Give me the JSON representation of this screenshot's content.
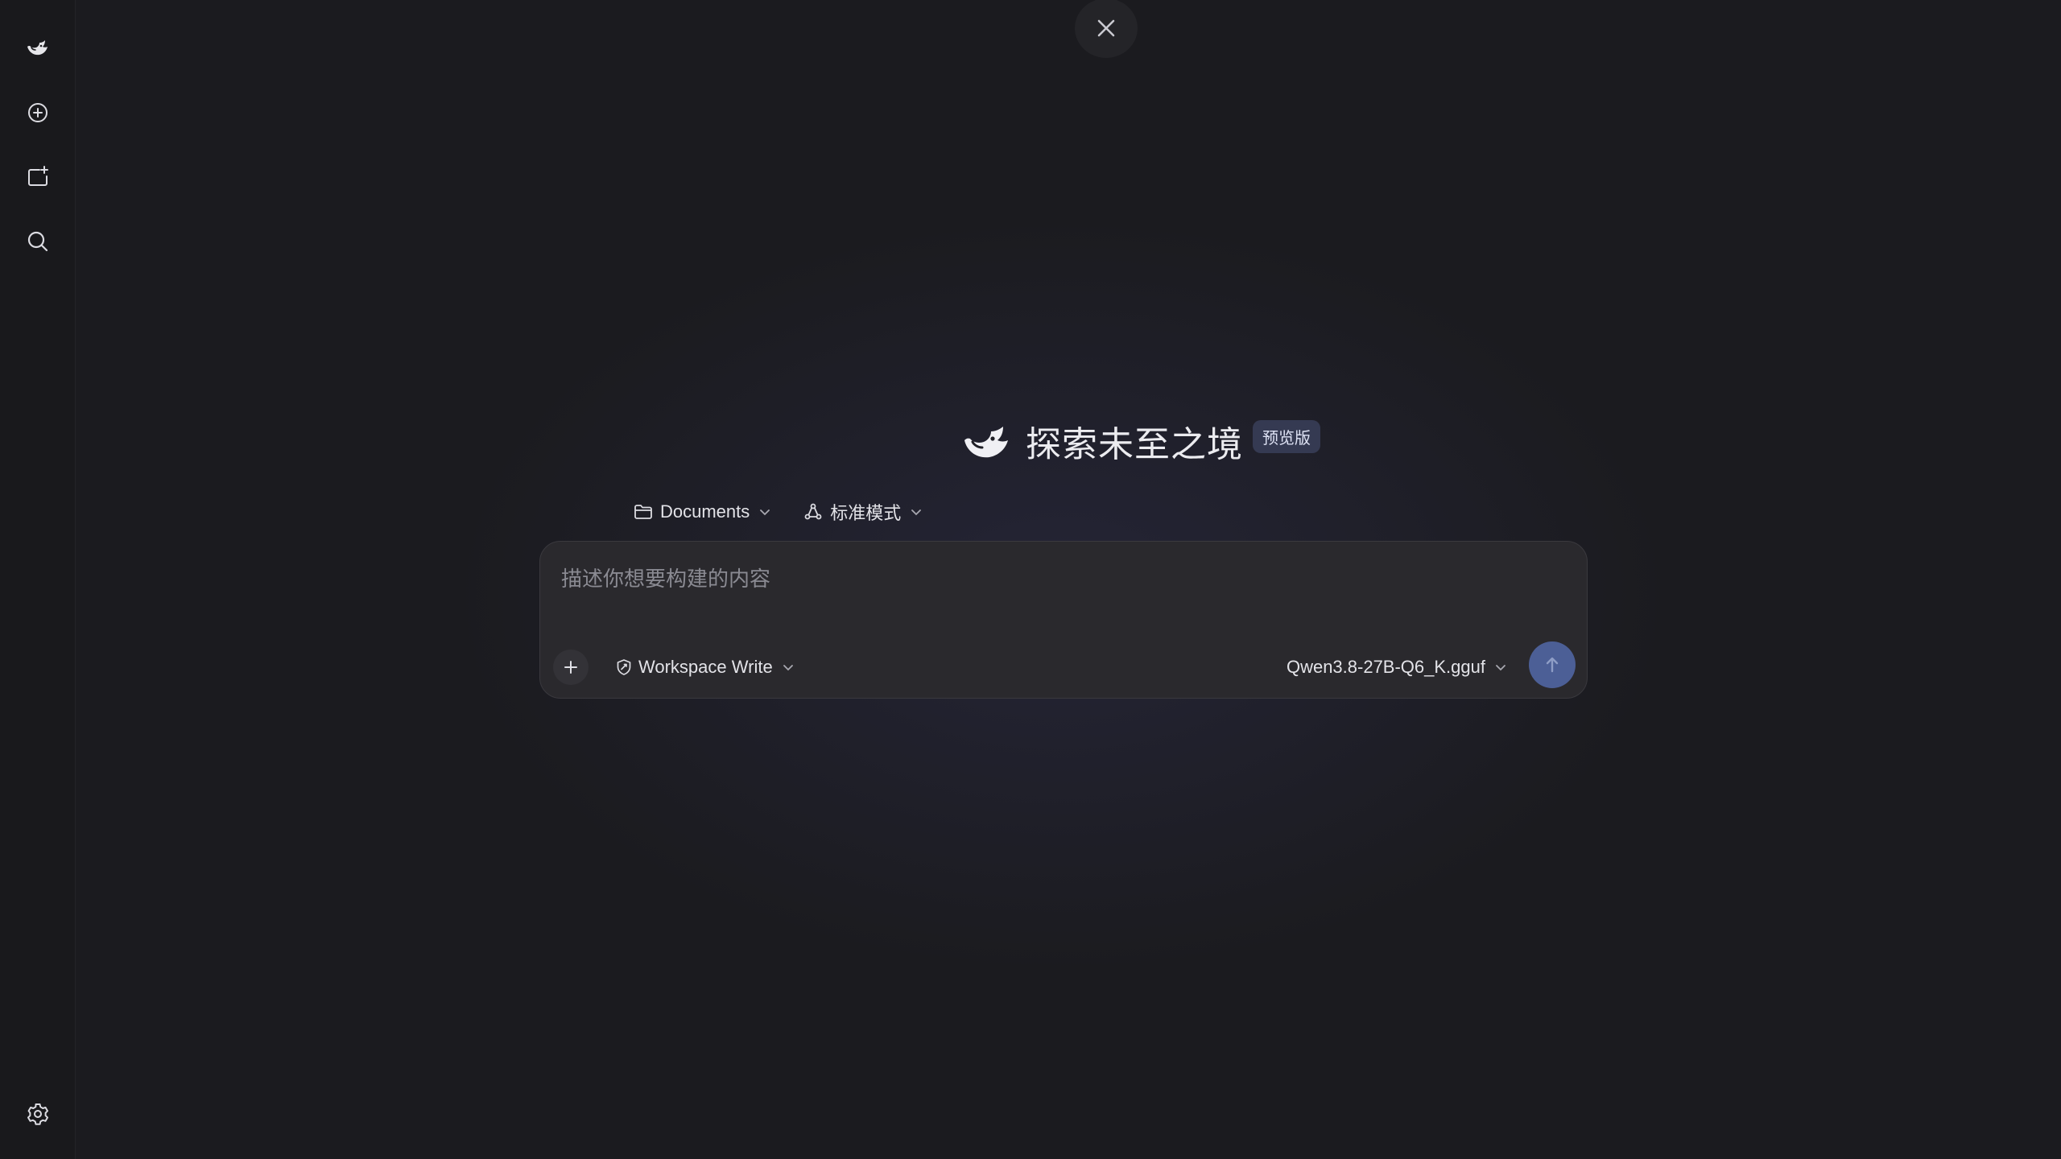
{
  "sidebar": {
    "items": [
      {
        "icon": "whale-logo-icon"
      },
      {
        "icon": "new-chat-icon"
      },
      {
        "icon": "new-project-icon"
      },
      {
        "icon": "search-icon"
      }
    ],
    "bottom": {
      "icon": "settings-icon"
    }
  },
  "close": {
    "icon": "close-icon"
  },
  "hero": {
    "title": "探索未至之境",
    "badge": "预览版",
    "logo_icon": "whale-logo-icon"
  },
  "selectors": {
    "folder": {
      "label": "Documents",
      "icon": "folder-icon"
    },
    "mode": {
      "label": "标准模式",
      "icon": "mode-icon"
    }
  },
  "composer": {
    "placeholder": "描述你想要构建的内容",
    "value": "",
    "permission": {
      "label": "Workspace Write",
      "icon": "shield-icon"
    },
    "model": {
      "label": "Qwen3.8-27B-Q6_K.gguf"
    },
    "send_icon": "arrow-up-icon"
  },
  "colors": {
    "background": "#1b1b1f",
    "sidebar": "#19191c",
    "composer": "#2a292d",
    "badge": "#353a52",
    "send": "#4c5f96"
  }
}
